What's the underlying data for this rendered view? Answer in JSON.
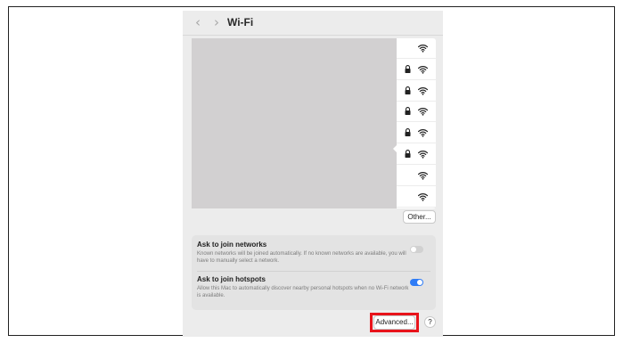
{
  "toolbar": {
    "back_glyph": "‹",
    "forward_glyph": "›",
    "title": "Wi-Fi"
  },
  "network_list": {
    "rows": [
      {
        "locked": false,
        "icon": "wifi-icon"
      },
      {
        "locked": true,
        "icon": "wifi-icon"
      },
      {
        "locked": true,
        "icon": "wifi-icon"
      },
      {
        "locked": true,
        "icon": "wifi-icon"
      },
      {
        "locked": true,
        "icon": "wifi-icon"
      },
      {
        "locked": true,
        "icon": "wifi-icon"
      },
      {
        "locked": false,
        "icon": "wifi-icon"
      },
      {
        "locked": false,
        "icon": "wifi-icon"
      }
    ],
    "other_label": "Other..."
  },
  "settings": {
    "ask_join_networks": {
      "title": "Ask to join networks",
      "description": "Known networks will be joined automatically. If no known networks are available, you will have to manually select a network.",
      "enabled": false
    },
    "ask_join_hotspots": {
      "title": "Ask to join hotspots",
      "description": "Allow this Mac to automatically discover nearby personal hotspots when no Wi-Fi network is available.",
      "enabled": true
    }
  },
  "footer": {
    "advanced_label": "Advanced...",
    "help_label": "?"
  },
  "colors": {
    "accent": "#2f7cf6",
    "highlight": "#e8141b",
    "redaction": "#d2d0d1"
  }
}
